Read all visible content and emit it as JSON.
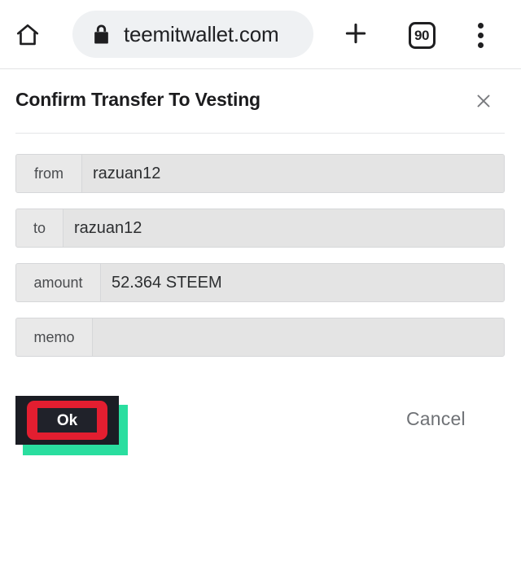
{
  "browser": {
    "home_icon": "home-icon",
    "lock_icon": "lock-icon",
    "url": "teemitwallet.com",
    "new_tab_icon": "plus-icon",
    "tab_count": "90",
    "overflow_icon": "more-vertical-icon"
  },
  "dialog": {
    "title": "Confirm Transfer To Vesting",
    "close_icon": "close-icon",
    "fields": [
      {
        "label": "from",
        "value": "razuan12",
        "label_width": 81
      },
      {
        "label": "to",
        "value": "razuan12",
        "label_width": 58
      },
      {
        "label": "amount",
        "value": "52.364 STEEM",
        "label_width": 104
      },
      {
        "label": "memo",
        "value": "",
        "label_width": 94
      }
    ],
    "ok_label": "Ok",
    "cancel_label": "Cancel"
  },
  "colors": {
    "annotation_teal": "#2ade9f",
    "annotation_red": "#e31e30",
    "annotation_dark": "#1b1d24",
    "url_pill_bg": "#eff1f3",
    "field_bg": "#e4e4e4",
    "cancel_text": "#6f7276"
  }
}
